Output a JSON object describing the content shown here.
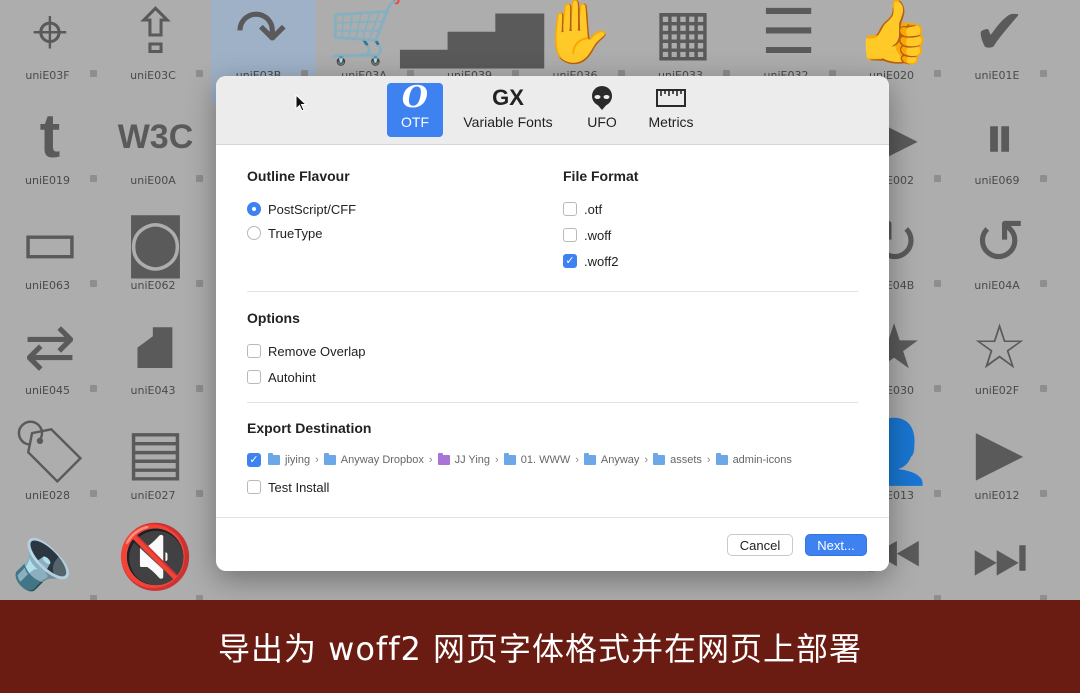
{
  "background": {
    "cells": [
      {
        "label": "uniE03F",
        "glyph": "⌖",
        "col": 0,
        "row": 0
      },
      {
        "label": "uniE03C",
        "glyph": "⇪",
        "col": 1,
        "row": 0
      },
      {
        "label": "uniE03B",
        "glyph": "↷",
        "col": 2,
        "row": 0,
        "selected": true
      },
      {
        "label": "uniE03A",
        "glyph": "🛒",
        "col": 3,
        "row": 0
      },
      {
        "label": "uniE039",
        "glyph": "▂▄▆",
        "col": 4,
        "row": 0
      },
      {
        "label": "uniE036",
        "glyph": "✋",
        "col": 5,
        "row": 0
      },
      {
        "label": "uniE033",
        "glyph": "▦",
        "col": 6,
        "row": 0
      },
      {
        "label": "uniE032",
        "glyph": "☰",
        "col": 7,
        "row": 0
      },
      {
        "label": "uniE020",
        "glyph": "👍",
        "col": 8,
        "row": 0
      },
      {
        "label": "uniE01E",
        "glyph": "✔",
        "col": 9,
        "row": 0
      },
      {
        "label": "uniE019",
        "glyph": "t",
        "col": 0,
        "row": 1,
        "text": true
      },
      {
        "label": "uniE00A",
        "glyph": "W3C",
        "col": 1,
        "row": 1,
        "text": true
      },
      {
        "label": "uniE002",
        "glyph": "▶",
        "col": 8,
        "row": 1
      },
      {
        "label": "uniE069",
        "glyph": "⏸",
        "col": 9,
        "row": 1
      },
      {
        "label": "uniE063",
        "glyph": "▭",
        "col": 0,
        "row": 2
      },
      {
        "label": "uniE062",
        "glyph": "◙",
        "col": 1,
        "row": 2
      },
      {
        "label": "uniE04B",
        "glyph": "↻",
        "col": 8,
        "row": 2
      },
      {
        "label": "uniE04A",
        "glyph": "↺",
        "col": 9,
        "row": 2
      },
      {
        "label": "uniE045",
        "glyph": "⇄",
        "col": 0,
        "row": 3
      },
      {
        "label": "uniE043",
        "glyph": "⛘",
        "col": 1,
        "row": 3
      },
      {
        "label": "uniE030",
        "glyph": "★",
        "col": 8,
        "row": 3
      },
      {
        "label": "uniE02F",
        "glyph": "☆",
        "col": 9,
        "row": 3
      },
      {
        "label": "uniE028",
        "glyph": "🏷",
        "col": 0,
        "row": 4
      },
      {
        "label": "uniE027",
        "glyph": "▤",
        "col": 1,
        "row": 4
      },
      {
        "label": "uniE013",
        "glyph": "👤",
        "col": 8,
        "row": 4
      },
      {
        "label": "uniE012",
        "glyph": "▶",
        "col": 9,
        "row": 4
      },
      {
        "label": "",
        "glyph": "🔈",
        "col": 0,
        "row": 5
      },
      {
        "label": "",
        "glyph": "🔇",
        "col": 1,
        "row": 5
      },
      {
        "label": "",
        "glyph": "⏮",
        "col": 8,
        "row": 5
      },
      {
        "label": "",
        "glyph": "⏭",
        "col": 9,
        "row": 5
      }
    ]
  },
  "toolbar": {
    "tabs": [
      {
        "label": "OTF",
        "icon": "O",
        "icon_name": "otf-icon",
        "active": true
      },
      {
        "label": "Variable Fonts",
        "icon": "GX",
        "icon_name": "gx-icon",
        "active": false
      },
      {
        "label": "UFO",
        "icon": "👽",
        "icon_name": "alien-icon",
        "active": false
      },
      {
        "label": "Metrics",
        "icon": "📏",
        "icon_name": "ruler-icon",
        "active": false
      }
    ]
  },
  "outline": {
    "title": "Outline Flavour",
    "options": [
      {
        "label": "PostScript/CFF",
        "selected": true
      },
      {
        "label": "TrueType",
        "selected": false
      }
    ]
  },
  "file_format": {
    "title": "File Format",
    "options": [
      {
        "label": ".otf",
        "checked": false
      },
      {
        "label": ".woff",
        "checked": false
      },
      {
        "label": ".woff2",
        "checked": true
      }
    ]
  },
  "options": {
    "title": "Options",
    "items": [
      {
        "label": "Remove Overlap",
        "checked": false
      },
      {
        "label": "Autohint",
        "checked": false
      }
    ]
  },
  "export": {
    "title": "Export Destination",
    "destination_checked": true,
    "path": [
      {
        "name": "jiying",
        "icon": "home-folder-icon"
      },
      {
        "name": "Anyway Dropbox",
        "icon": "folder-icon"
      },
      {
        "name": "JJ Ying",
        "icon": "purple-folder-icon"
      },
      {
        "name": "01. WWW",
        "icon": "folder-icon"
      },
      {
        "name": "Anyway",
        "icon": "folder-icon"
      },
      {
        "name": "assets",
        "icon": "folder-icon"
      },
      {
        "name": "admin-icons",
        "icon": "folder-icon"
      }
    ],
    "test_install": {
      "label": "Test Install",
      "checked": false
    }
  },
  "buttons": {
    "cancel": "Cancel",
    "next": "Next..."
  },
  "caption": "导出为 woff2 网页字体格式并在网页上部署",
  "colors": {
    "accent": "#3d82f0",
    "caption_bg": "#6b1c12"
  }
}
